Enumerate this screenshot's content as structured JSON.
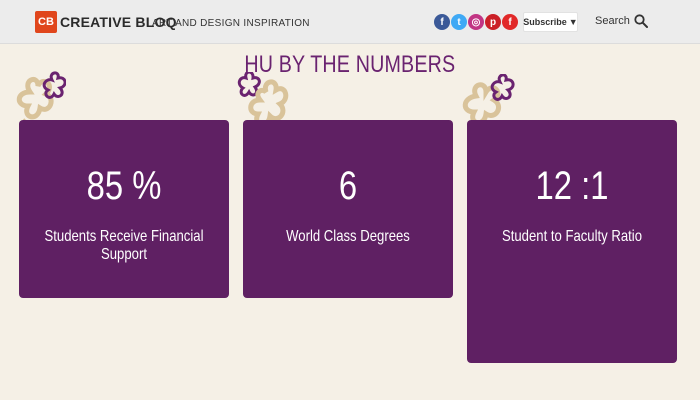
{
  "header": {
    "logo_badge": "CB",
    "logo_text": "CREATIVE BLOQ",
    "tagline": "ART AND DESIGN INSPIRATION",
    "social": [
      {
        "icon": "facebook-icon",
        "glyph": "f",
        "color": "#3b5998"
      },
      {
        "icon": "twitter-icon",
        "glyph": "t",
        "color": "#3fa9f5"
      },
      {
        "icon": "instagram-icon",
        "glyph": "◎",
        "color": "#c13584"
      },
      {
        "icon": "pinterest-icon",
        "glyph": "p",
        "color": "#cb2027"
      },
      {
        "icon": "flipboard-icon",
        "glyph": "f",
        "color": "#e12828"
      }
    ],
    "subscribe_label": "Subscribe",
    "subscribe_caret": "▼",
    "search_label": "Search"
  },
  "section": {
    "heading": "HU BY THE NUMBERS"
  },
  "stats": [
    {
      "value": "85 %",
      "label": "Students Receive Financial Support"
    },
    {
      "value": "6",
      "label": "World Class Degrees"
    },
    {
      "value": "12 :1",
      "label": "Student to Faculty Ratio"
    }
  ],
  "colors": {
    "accent": "#5f2063",
    "heading": "#6a2370",
    "background": "#f5f0e6",
    "flower_tan": "#d9c39a",
    "flower_purple": "#6a2370"
  }
}
